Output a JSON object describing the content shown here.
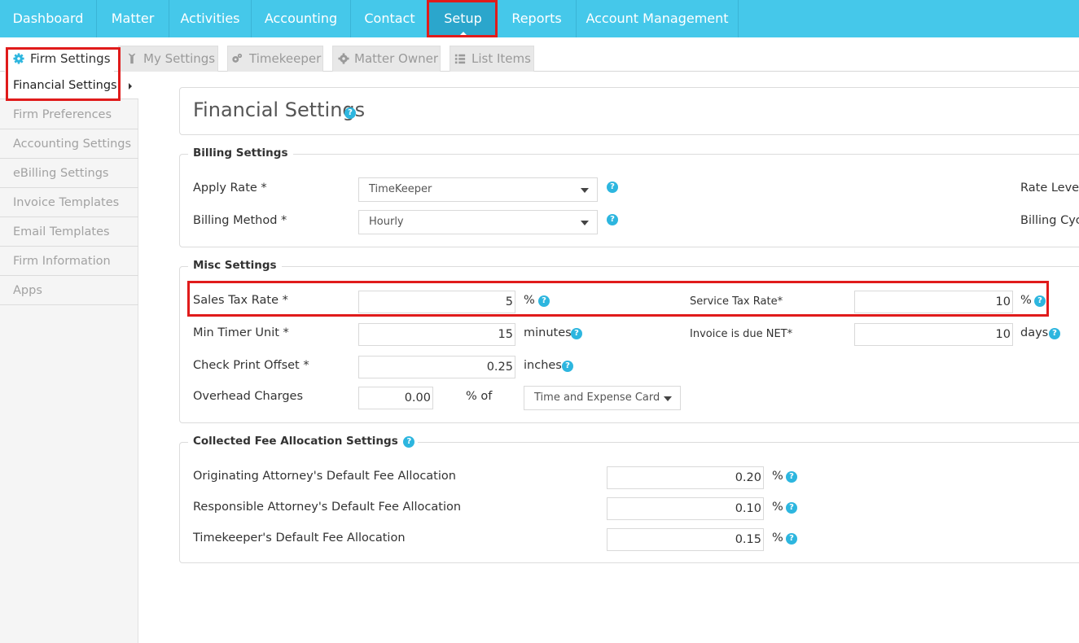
{
  "topnav": {
    "items": [
      "Dashboard",
      "Matter",
      "Activities",
      "Accounting",
      "Contact",
      "Setup",
      "Reports",
      "Account Management"
    ],
    "active": "Setup"
  },
  "subtabs": {
    "items": [
      "Firm Settings",
      "My Settings",
      "Timekeeper",
      "Matter Owner",
      "List Items"
    ],
    "active": "Firm Settings"
  },
  "sidebar": {
    "items": [
      "Financial Settings",
      "Firm Preferences",
      "Accounting Settings",
      "eBilling Settings",
      "Invoice Templates",
      "Email Templates",
      "Firm Information",
      "Apps"
    ],
    "active": "Financial Settings"
  },
  "page": {
    "title": "Financial Settings"
  },
  "billing": {
    "legend": "Billing Settings",
    "apply_rate_label": "Apply Rate *",
    "apply_rate_value": "TimeKeeper",
    "billing_method_label": "Billing Method *",
    "billing_method_value": "Hourly",
    "rate_level_label": "Rate Level",
    "billing_cycle_label": "Billing Cycl"
  },
  "misc": {
    "legend": "Misc Settings",
    "sales_tax_label": "Sales Tax Rate *",
    "sales_tax_value": "5",
    "sales_tax_unit": "%",
    "service_tax_label": "Service Tax Rate*",
    "service_tax_value": "10",
    "service_tax_unit": "%",
    "min_timer_label": "Min Timer Unit *",
    "min_timer_value": "15",
    "min_timer_unit": "minutes",
    "invoice_due_label": "Invoice is due NET*",
    "invoice_due_value": "10",
    "invoice_due_unit": "days",
    "check_offset_label": "Check Print Offset *",
    "check_offset_value": "0.25",
    "check_offset_unit": "inches",
    "overhead_label": "Overhead Charges",
    "overhead_value": "0.00",
    "overhead_unit": "% of",
    "overhead_select": "Time and Expense Card"
  },
  "allocation": {
    "legend": "Collected Fee Allocation Settings",
    "orig_label": "Originating Attorney's Default Fee Allocation",
    "orig_value": "0.20",
    "resp_label": "Responsible Attorney's Default Fee Allocation",
    "resp_value": "0.10",
    "tk_label": "Timekeeper's Default Fee Allocation",
    "tk_value": "0.15",
    "unit": "%"
  },
  "help_glyph": "?",
  "colors": {
    "nav_bg": "#45c8ea",
    "nav_active": "#2ba6cc",
    "help": "#2db6df",
    "highlight": "#e01b1b"
  }
}
